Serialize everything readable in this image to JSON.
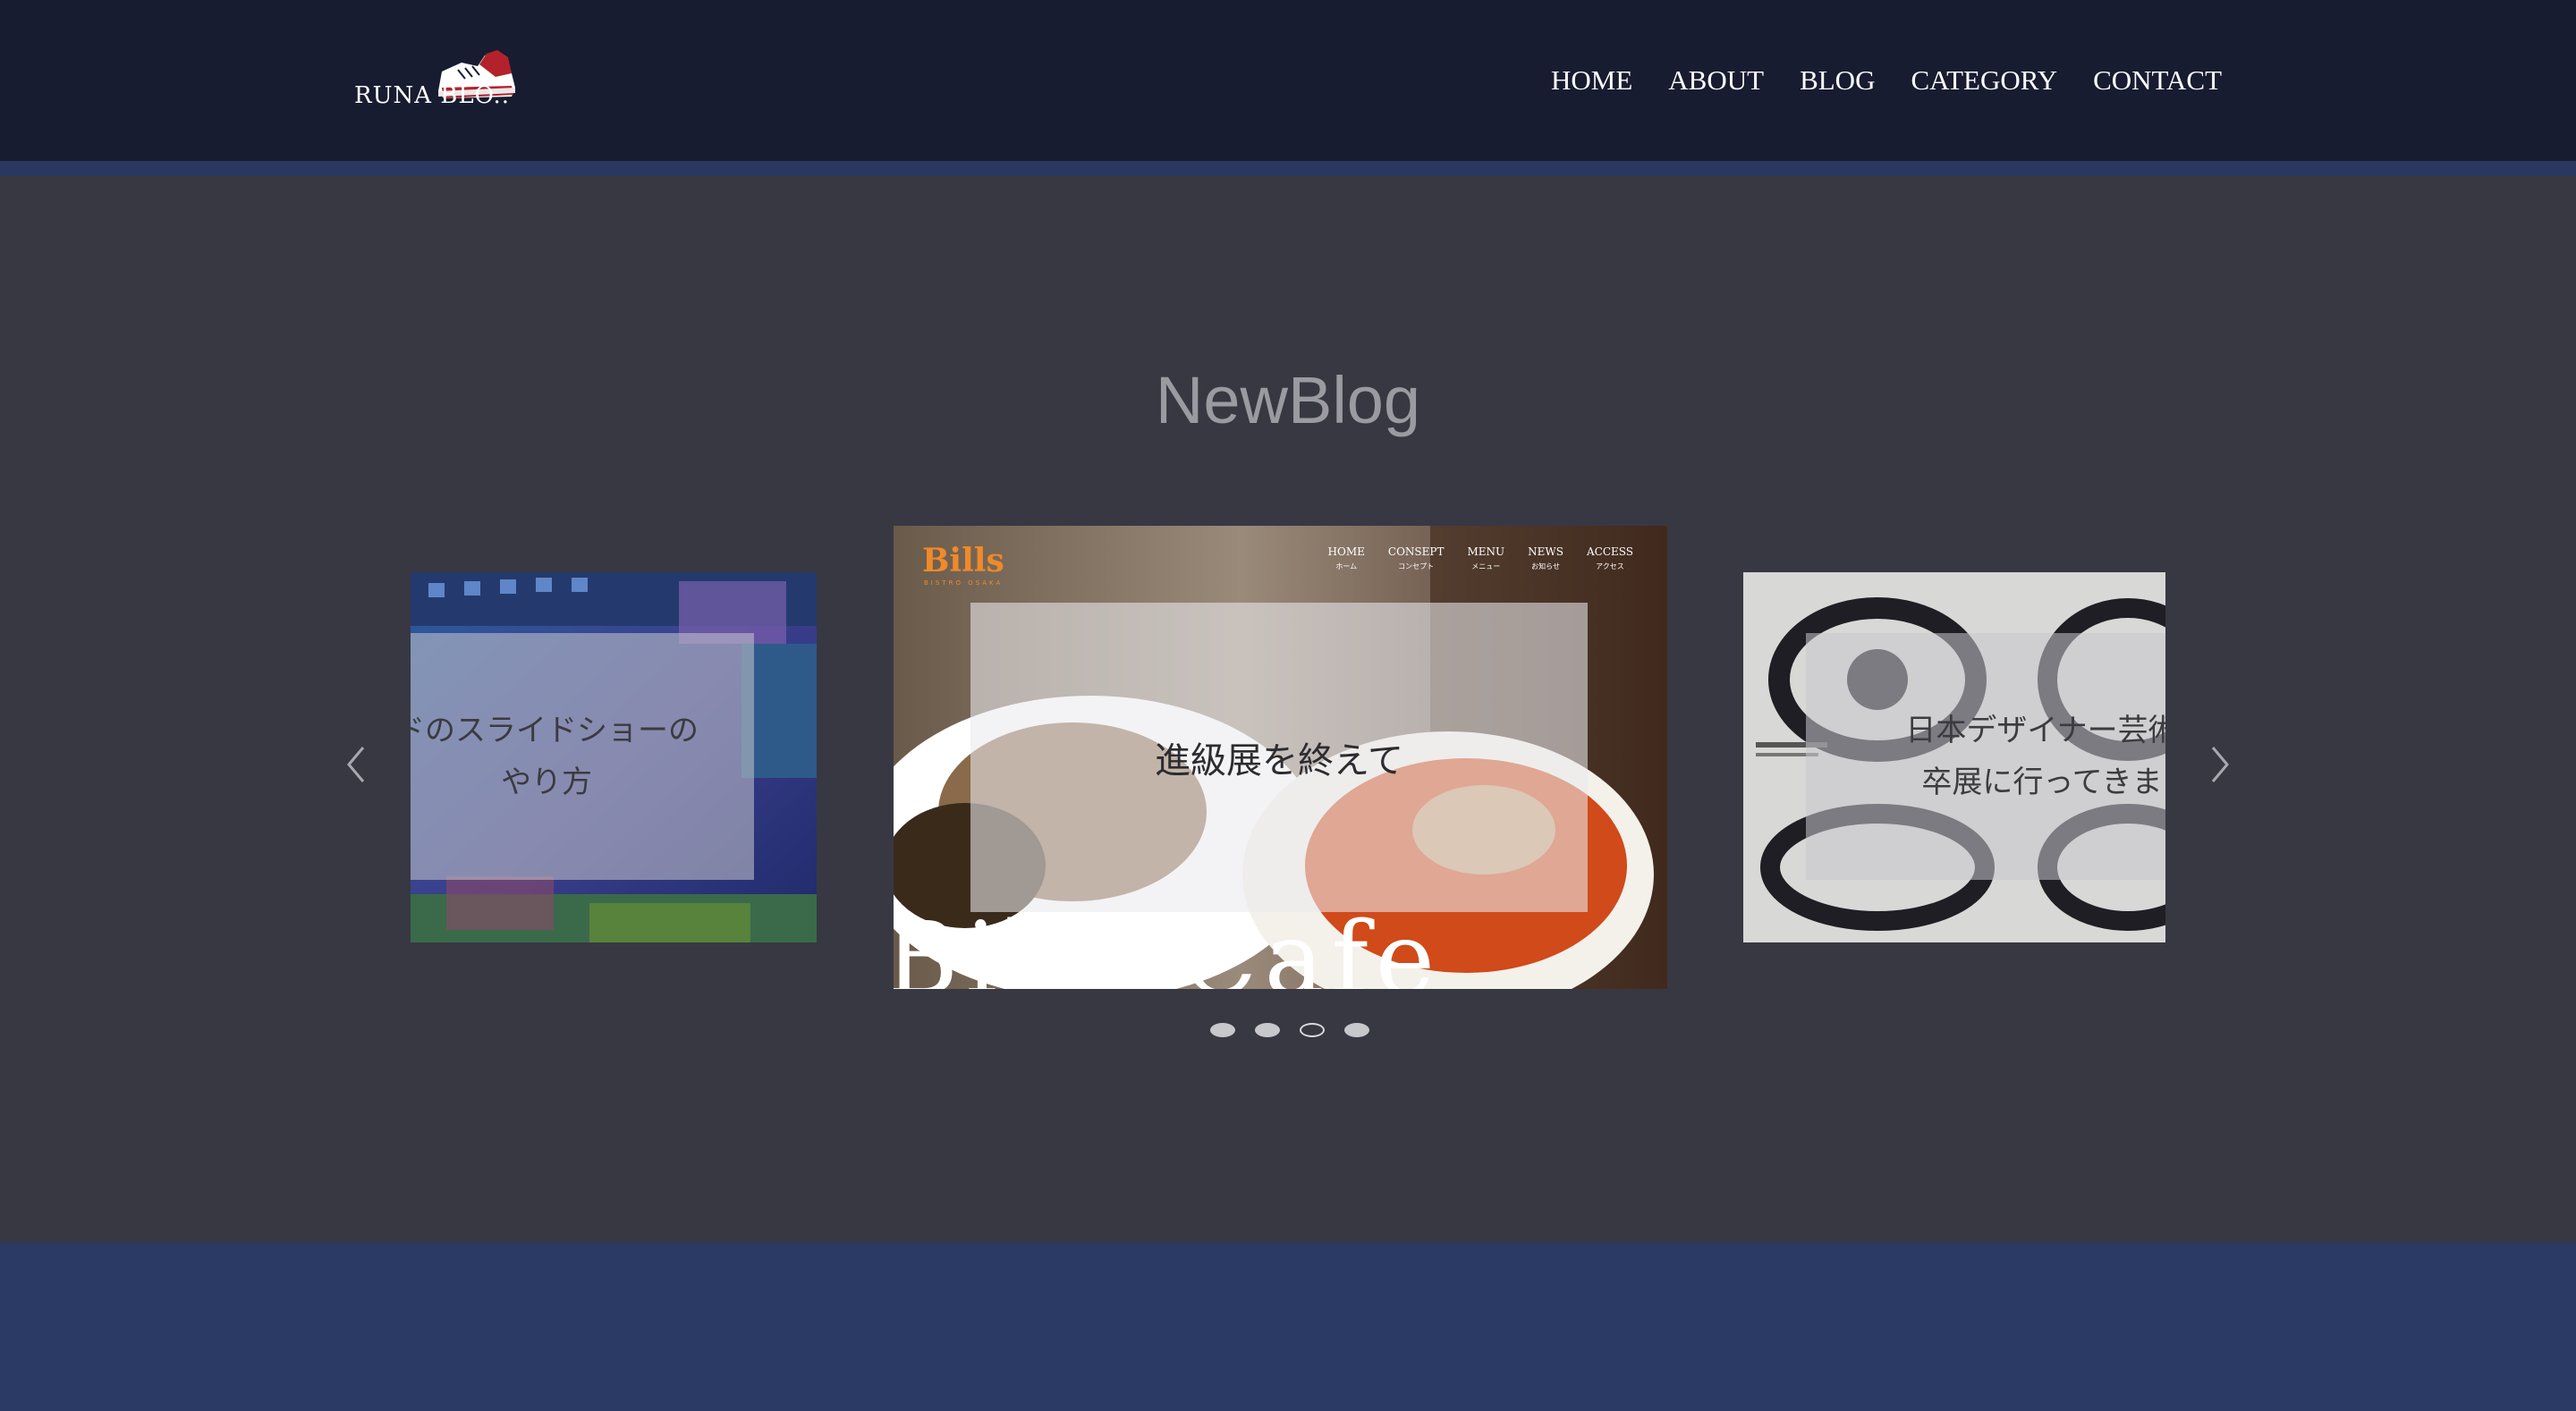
{
  "header": {
    "logo_text": "RUNA BLO..",
    "nav": [
      "HOME",
      "ABOUT",
      "BLOG",
      "CATEGORY",
      "CONTACT"
    ]
  },
  "section": {
    "title": "NewBlog"
  },
  "slides": {
    "left": {
      "line1": "ドのスライドショーの",
      "line2": "やり方"
    },
    "center": {
      "caption": "進級展を終えて",
      "site_logo": "Bills",
      "site_logo_sub": "BISTRO OSAKA",
      "site_nav": [
        {
          "en": "HOME",
          "jp": "ホーム"
        },
        {
          "en": "CONSEPT",
          "jp": "コンセプト"
        },
        {
          "en": "MENU",
          "jp": "メニュー"
        },
        {
          "en": "NEWS",
          "jp": "お知らせ"
        },
        {
          "en": "ACCESS",
          "jp": "アクセス"
        }
      ],
      "watermark": "Bills Cafe"
    },
    "right": {
      "line1": "日本デザイナー芸術学",
      "line2": "卒展に行ってきまし"
    }
  },
  "carousel": {
    "active_index": 2,
    "dot_count": 4,
    "prev_icon": "chevron-left-icon",
    "next_icon": "chevron-right-icon"
  },
  "colors": {
    "header_bg": "#171c31",
    "stripe": "#2a3860",
    "section_bg": "#383842",
    "footer_bg": "#2b3a64"
  }
}
